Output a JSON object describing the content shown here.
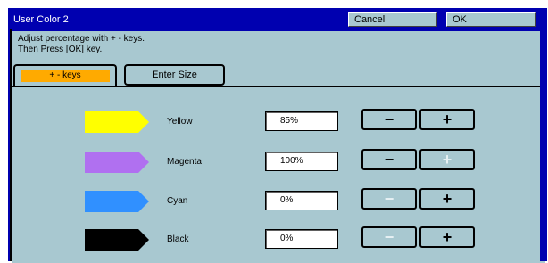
{
  "window": {
    "title": "User Color 2",
    "cancel_label": "Cancel",
    "ok_label": "OK"
  },
  "instructions": {
    "line1": "Adjust percentage with + - keys.",
    "line2": "Then Press [OK] key."
  },
  "tabs": [
    {
      "label": "+ - keys",
      "active": true
    },
    {
      "label": "Enter Size",
      "active": false
    }
  ],
  "colors": [
    {
      "name": "Yellow",
      "value": "85%",
      "swatch": "#ffff00",
      "minus_enabled": true,
      "plus_enabled": true,
      "minus": "−",
      "plus": "+"
    },
    {
      "name": "Magenta",
      "value": "100%",
      "swatch": "#b070f0",
      "minus_enabled": true,
      "plus_enabled": false,
      "minus": "−",
      "plus": "+"
    },
    {
      "name": "Cyan",
      "value": "0%",
      "swatch": "#3090ff",
      "minus_enabled": false,
      "plus_enabled": true,
      "minus": "−",
      "plus": "+"
    },
    {
      "name": "Black",
      "value": "0%",
      "swatch": "#000000",
      "minus_enabled": false,
      "plus_enabled": true,
      "minus": "−",
      "plus": "+"
    }
  ],
  "theme": {
    "frame": "#0000b0",
    "panel": "#a8c8d0",
    "active_tab": "#ffaa00"
  }
}
